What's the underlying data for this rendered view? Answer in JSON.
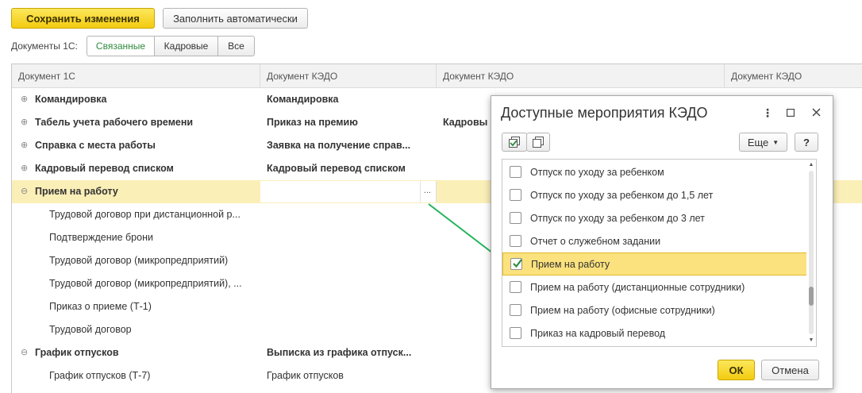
{
  "toolbar": {
    "save_label": "Сохранить изменения",
    "autofill_label": "Заполнить автоматически"
  },
  "filter": {
    "label": "Документы 1С:",
    "options": [
      "Связанные",
      "Кадровые",
      "Все"
    ],
    "selected": "Связанные"
  },
  "table": {
    "columns": [
      "Документ 1С",
      "Документ КЭДО",
      "Документ КЭДО",
      "Документ КЭДО"
    ],
    "rows": [
      {
        "doc1c": "Командировка",
        "kedo1": "Командировка",
        "kedo2": "",
        "group": true,
        "expanded": false
      },
      {
        "doc1c": "Табель учета рабочего времени",
        "kedo1": "Приказ на премию",
        "kedo2": "Кадровы",
        "group": true,
        "expanded": false
      },
      {
        "doc1c": "Справка с места работы",
        "kedo1": "Заявка на получение справ...",
        "kedo2": "",
        "group": true,
        "expanded": false
      },
      {
        "doc1c": "Кадровый перевод списком",
        "kedo1": "Кадровый перевод списком",
        "kedo2": "",
        "group": true,
        "expanded": false
      },
      {
        "doc1c": "Прием на работу",
        "kedo1": "",
        "kedo2": "",
        "group": true,
        "expanded": true,
        "selected": true
      },
      {
        "doc1c": "Трудовой договор при дистанционной р...",
        "kedo1": "",
        "kedo2": "",
        "group": false
      },
      {
        "doc1c": "Подтверждение брони",
        "kedo1": "",
        "kedo2": "",
        "group": false
      },
      {
        "doc1c": "Трудовой договор (микропредприятий)",
        "kedo1": "",
        "kedo2": "",
        "group": false
      },
      {
        "doc1c": "Трудовой договор (микропредприятий), ...",
        "kedo1": "",
        "kedo2": "",
        "group": false
      },
      {
        "doc1c": "Приказ о приеме (Т-1)",
        "kedo1": "",
        "kedo2": "",
        "group": false
      },
      {
        "doc1c": "Трудовой договор",
        "kedo1": "",
        "kedo2": "",
        "group": false
      },
      {
        "doc1c": "График отпусков",
        "kedo1": "Выписка из графика отпуск...",
        "kedo2": "",
        "group": true,
        "expanded": true
      },
      {
        "doc1c": "График отпусков (Т-7)",
        "kedo1": "График отпусков",
        "kedo2": "",
        "group": false
      }
    ],
    "edit_button": "..."
  },
  "dialog": {
    "title": "Доступные мероприятия КЭДО",
    "more_label": "Еще",
    "help_label": "?",
    "items": [
      {
        "label": "Отпуск по уходу за ребенком",
        "checked": false
      },
      {
        "label": "Отпуск по уходу за ребенком до 1,5 лет",
        "checked": false
      },
      {
        "label": "Отпуск по уходу за ребенком до 3 лет",
        "checked": false
      },
      {
        "label": "Отчет о служебном задании",
        "checked": false
      },
      {
        "label": "Прием на работу",
        "checked": true,
        "selected": true
      },
      {
        "label": "Прием на работу (дистанционные сотрудники)",
        "checked": false
      },
      {
        "label": "Прием на работу (офисные сотрудники)",
        "checked": false
      },
      {
        "label": "Приказ на кадровый перевод",
        "checked": false
      }
    ],
    "ok_label": "ОК",
    "cancel_label": "Отмена"
  },
  "colors": {
    "accent": "#f3cc10",
    "selection": "#fbefb8",
    "arrow": "#22b35a",
    "active_filter": "#2e8b3d"
  }
}
